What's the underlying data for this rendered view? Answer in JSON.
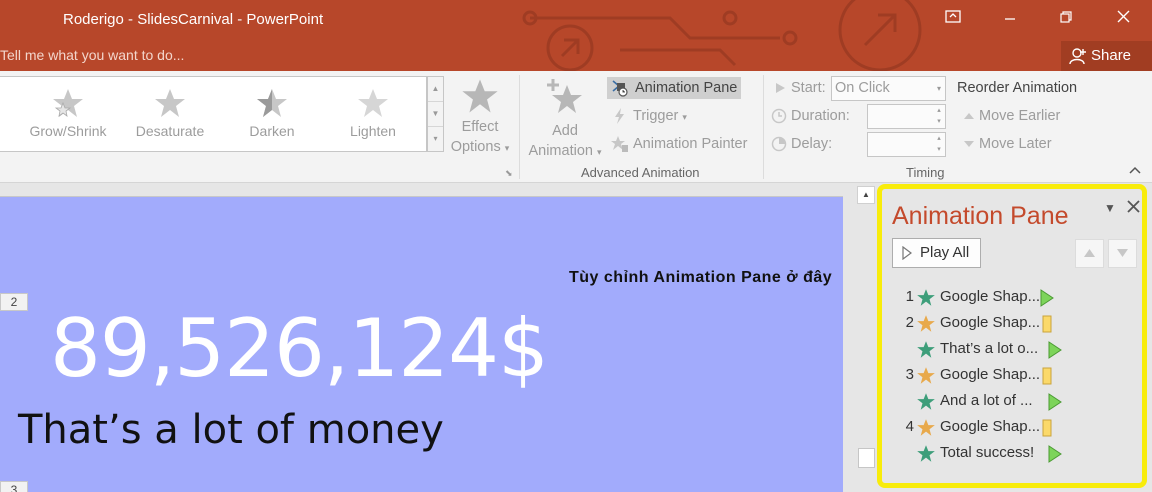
{
  "window": {
    "title": "Roderigo - SlidesCarnival - PowerPoint",
    "tell_me_placeholder": "Tell me what you want to do...",
    "share_label": "Share"
  },
  "ribbon": {
    "gallery": [
      {
        "label": "Grow/Shrink",
        "icon": "grow-shrink-star-icon"
      },
      {
        "label": "Desaturate",
        "icon": "desaturate-star-icon"
      },
      {
        "label": "Darken",
        "icon": "darken-star-icon"
      },
      {
        "label": "Lighten",
        "icon": "lighten-star-icon"
      }
    ],
    "effect_options": {
      "line1": "Effect",
      "line2": "Options"
    },
    "add_animation": {
      "line1": "Add",
      "line2": "Animation"
    },
    "animation_pane_label": "Animation Pane",
    "trigger_label": "Trigger",
    "animation_painter_label": "Animation Painter",
    "advanced_group_label": "Advanced Animation",
    "start_label": "Start:",
    "start_value": "On Click",
    "duration_label": "Duration:",
    "duration_value": "",
    "delay_label": "Delay:",
    "delay_value": "",
    "timing_group_label": "Timing",
    "reorder_title": "Reorder Animation",
    "move_earlier_label": "Move Earlier",
    "move_later_label": "Move Later"
  },
  "slide": {
    "big_number": "89,526,124$",
    "subtitle": "That’s a lot of money",
    "slide_numbers": [
      "2",
      "3"
    ]
  },
  "caption": "Tùy chỉnh Animation Pane ở đây",
  "animation_pane": {
    "title": "Animation Pane",
    "play_all_label": "Play All",
    "items": [
      {
        "num": "1",
        "label": "Google Shap...",
        "star": "green",
        "bar": "play"
      },
      {
        "num": "2",
        "label": "Google Shap...",
        "star": "gold",
        "bar": "emphasis"
      },
      {
        "num": "",
        "label": "That’s a lot o...",
        "star": "green",
        "bar": "play"
      },
      {
        "num": "3",
        "label": "Google Shap...",
        "star": "gold",
        "bar": "emphasis"
      },
      {
        "num": "",
        "label": "And a lot of ...",
        "star": "green",
        "bar": "play"
      },
      {
        "num": "4",
        "label": "Google Shap...",
        "star": "gold",
        "bar": "emphasis"
      },
      {
        "num": "",
        "label": "Total success!",
        "star": "green",
        "bar": "play"
      }
    ]
  },
  "colors": {
    "title_bar": "#b7472a",
    "slide_background": "#a2abfc",
    "highlight_border": "#f8ec0b",
    "pane_title": "#c44a2c",
    "entrance_star": "#3d9e7a",
    "emphasis_star": "#e8a94b"
  }
}
